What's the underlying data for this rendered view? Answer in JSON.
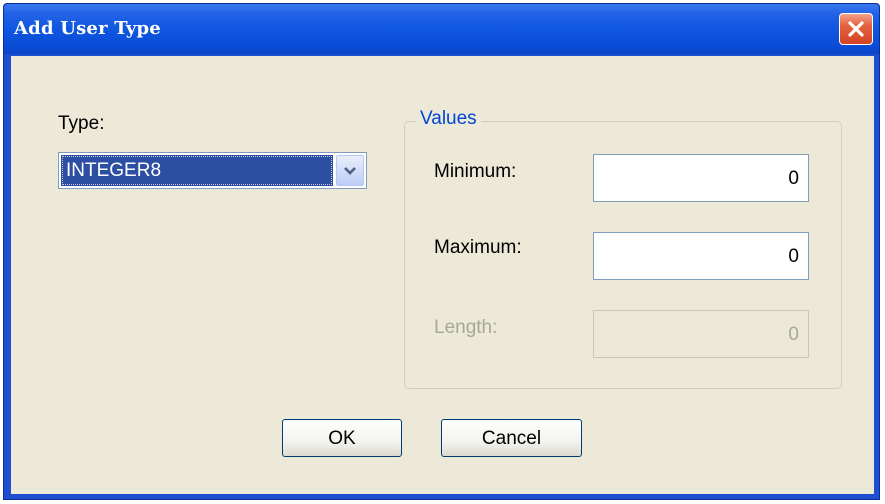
{
  "window": {
    "title": "Add User Type"
  },
  "type_label": "Type:",
  "type_select": {
    "value": "INTEGER8"
  },
  "values_group": {
    "legend": "Values",
    "minimum": {
      "label": "Minimum:",
      "value": "0"
    },
    "maximum": {
      "label": "Maximum:",
      "value": "0"
    },
    "length": {
      "label": "Length:",
      "value": "0",
      "disabled": true
    }
  },
  "buttons": {
    "ok": "OK",
    "cancel": "Cancel"
  },
  "icons": {
    "close": "close-icon",
    "dropdown": "chevron-down-icon"
  },
  "colors": {
    "titlebar": "#0a4cd6",
    "selection": "#2d4fa3",
    "close_button": "#d24323",
    "group_legend": "#0046d5"
  }
}
